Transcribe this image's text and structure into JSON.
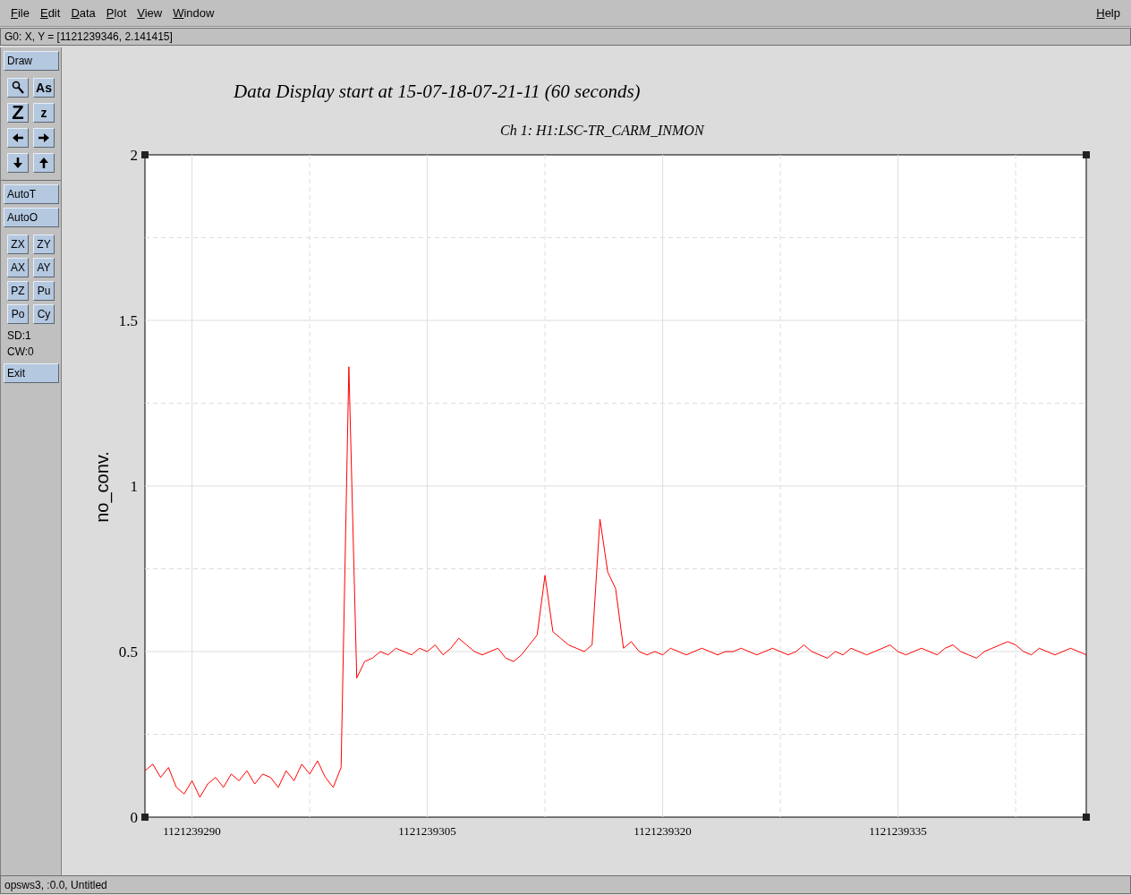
{
  "menu_bar": {
    "items": [
      {
        "label": "File"
      },
      {
        "label": "Edit"
      },
      {
        "label": "Data"
      },
      {
        "label": "Plot"
      },
      {
        "label": "View"
      },
      {
        "label": "Window"
      }
    ],
    "help": {
      "label": "Help"
    }
  },
  "coordinate_readout": "G0: X, Y = [1121239346, 2.141415]",
  "sidebar": {
    "draw_button": "Draw",
    "tools": [
      {
        "kind": "magnifier"
      },
      {
        "kind": "glyph",
        "label": "As"
      },
      {
        "kind": "big-glyph",
        "label": "Z"
      },
      {
        "kind": "glyph",
        "label": "z"
      },
      {
        "kind": "arrow-left"
      },
      {
        "kind": "arrow-right"
      },
      {
        "kind": "arrow-down"
      },
      {
        "kind": "arrow-up"
      }
    ],
    "auto_buttons": [
      "AutoT",
      "AutoO"
    ],
    "pair_buttons": [
      "ZX",
      "ZY",
      "AX",
      "AY",
      "PZ",
      "Pu",
      "Po",
      "Cy"
    ],
    "readouts": [
      "SD:1",
      "CW:0"
    ],
    "exit_button": "Exit"
  },
  "plot": {
    "chart_data": {
      "type": "line",
      "title": "Data Display start at 15-07-18-07-21-11 (60 seconds)",
      "ylabel": "no_conv.",
      "x": [
        1121239287,
        1121239287.5,
        1121239288,
        1121239288.5,
        1121239289,
        1121239289.5,
        1121239290,
        1121239290.5,
        1121239291,
        1121239291.5,
        1121239292,
        1121239292.5,
        1121239293,
        1121239293.5,
        1121239294,
        1121239294.5,
        1121239295,
        1121239295.5,
        1121239296,
        1121239296.5,
        1121239297,
        1121239297.5,
        1121239298,
        1121239298.5,
        1121239299,
        1121239299.5,
        1121239300,
        1121239300.5,
        1121239301,
        1121239301.5,
        1121239302,
        1121239302.5,
        1121239303,
        1121239303.5,
        1121239304,
        1121239304.5,
        1121239305,
        1121239305.5,
        1121239306,
        1121239306.5,
        1121239307,
        1121239307.5,
        1121239308,
        1121239308.5,
        1121239309,
        1121239309.5,
        1121239310,
        1121239310.5,
        1121239311,
        1121239311.5,
        1121239312,
        1121239312.5,
        1121239313,
        1121239313.5,
        1121239314,
        1121239314.5,
        1121239315,
        1121239315.5,
        1121239316,
        1121239316.5,
        1121239317,
        1121239317.5,
        1121239318,
        1121239318.5,
        1121239319,
        1121239319.5,
        1121239320,
        1121239320.5,
        1121239321,
        1121239321.5,
        1121239322,
        1121239322.5,
        1121239323,
        1121239323.5,
        1121239324,
        1121239324.5,
        1121239325,
        1121239325.5,
        1121239326,
        1121239326.5,
        1121239327,
        1121239327.5,
        1121239328,
        1121239328.5,
        1121239329,
        1121239329.5,
        1121239330,
        1121239330.5,
        1121239331,
        1121239331.5,
        1121239332,
        1121239332.5,
        1121239333,
        1121239333.5,
        1121239334,
        1121239334.5,
        1121239335,
        1121239335.5,
        1121239336,
        1121239336.5,
        1121239337,
        1121239337.5,
        1121239338,
        1121239338.5,
        1121239339,
        1121239339.5,
        1121239340,
        1121239340.5,
        1121239341,
        1121239341.5,
        1121239342,
        1121239342.5,
        1121239343,
        1121239343.5,
        1121239344,
        1121239344.5,
        1121239345,
        1121239345.5,
        1121239346,
        1121239346.5,
        1121239347
      ],
      "series": [
        {
          "name": "Ch 1: H1:LSC-TR_CARM_INMON",
          "color": "#ff0000",
          "values": [
            0.14,
            0.16,
            0.12,
            0.15,
            0.09,
            0.07,
            0.11,
            0.06,
            0.1,
            0.12,
            0.09,
            0.13,
            0.11,
            0.14,
            0.1,
            0.13,
            0.12,
            0.09,
            0.14,
            0.11,
            0.16,
            0.13,
            0.17,
            0.12,
            0.09,
            0.15,
            1.36,
            0.42,
            0.47,
            0.48,
            0.5,
            0.49,
            0.51,
            0.5,
            0.49,
            0.51,
            0.5,
            0.52,
            0.49,
            0.51,
            0.54,
            0.52,
            0.5,
            0.49,
            0.5,
            0.51,
            0.48,
            0.47,
            0.49,
            0.52,
            0.55,
            0.73,
            0.56,
            0.54,
            0.52,
            0.51,
            0.5,
            0.52,
            0.9,
            0.74,
            0.69,
            0.51,
            0.53,
            0.5,
            0.49,
            0.5,
            0.49,
            0.51,
            0.5,
            0.49,
            0.5,
            0.51,
            0.5,
            0.49,
            0.5,
            0.5,
            0.51,
            0.5,
            0.49,
            0.5,
            0.51,
            0.5,
            0.49,
            0.5,
            0.52,
            0.5,
            0.49,
            0.48,
            0.5,
            0.49,
            0.51,
            0.5,
            0.49,
            0.5,
            0.51,
            0.52,
            0.5,
            0.49,
            0.5,
            0.51,
            0.5,
            0.49,
            0.51,
            0.52,
            0.5,
            0.49,
            0.48,
            0.5,
            0.51,
            0.52,
            0.53,
            0.52,
            0.5,
            0.49,
            0.51,
            0.5,
            0.49,
            0.5,
            0.51,
            0.5,
            0.49
          ]
        }
      ],
      "xlim": [
        1121239287,
        1121239347
      ],
      "ylim": [
        0,
        2
      ],
      "grid": true,
      "xticks": [
        {
          "value": 1121239290,
          "label": "1121239290"
        },
        {
          "value": 1121239305,
          "label": "1121239305"
        },
        {
          "value": 1121239320,
          "label": "1121239320"
        },
        {
          "value": 1121239335,
          "label": "1121239335"
        }
      ],
      "yticks": [
        {
          "value": 0,
          "label": "0"
        },
        {
          "value": 0.5,
          "label": "0.5"
        },
        {
          "value": 1,
          "label": "1"
        },
        {
          "value": 1.5,
          "label": "1.5"
        },
        {
          "value": 2,
          "label": "2"
        }
      ]
    }
  },
  "status_bar": "opsws3, :0.0, Untitled"
}
